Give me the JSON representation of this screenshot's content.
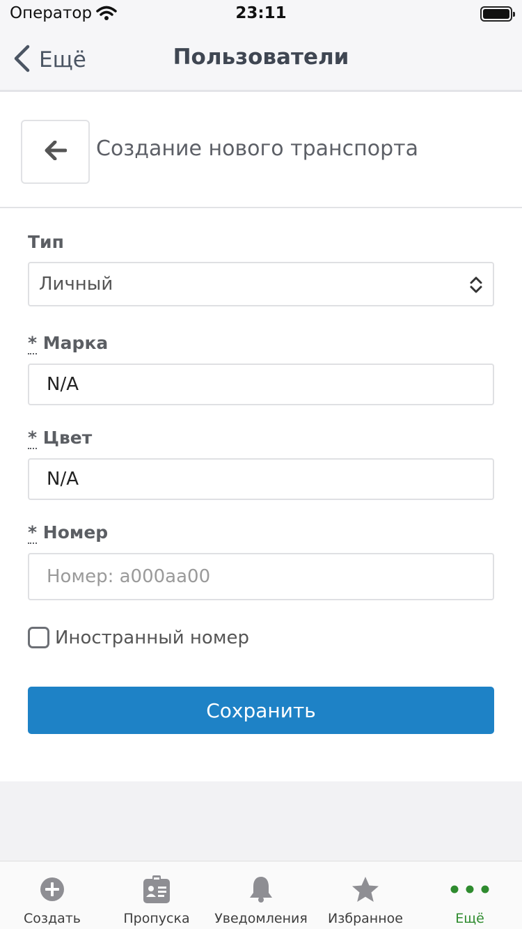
{
  "status_bar": {
    "carrier": "Оператор",
    "time": "23:11"
  },
  "nav": {
    "back_label": "Ещё",
    "title": "Пользователи"
  },
  "form": {
    "title": "Создание нового транспорта",
    "type": {
      "label": "Тип",
      "value": "Личный"
    },
    "brand": {
      "required_mark": "*",
      "label": "Марка",
      "value": "N/A"
    },
    "color": {
      "required_mark": "*",
      "label": "Цвет",
      "value": "N/A"
    },
    "number": {
      "required_mark": "*",
      "label": "Номер",
      "placeholder": "Номер: а000аа00",
      "value": ""
    },
    "foreign_number": {
      "label": "Иностранный номер",
      "checked": false
    },
    "save_label": "Сохранить"
  },
  "tabs": [
    {
      "label": "Создать",
      "icon": "plus-circle-icon",
      "active": false
    },
    {
      "label": "Пропуска",
      "icon": "badge-icon",
      "active": false
    },
    {
      "label": "Уведомления",
      "icon": "bell-icon",
      "active": false
    },
    {
      "label": "Избранное",
      "icon": "star-icon",
      "active": false
    },
    {
      "label": "Ещё",
      "icon": "more-dots-icon",
      "active": true
    }
  ],
  "colors": {
    "accent": "#1e82c6",
    "active_tab": "#2e8b2e",
    "inactive_icon": "#8e8e93"
  }
}
